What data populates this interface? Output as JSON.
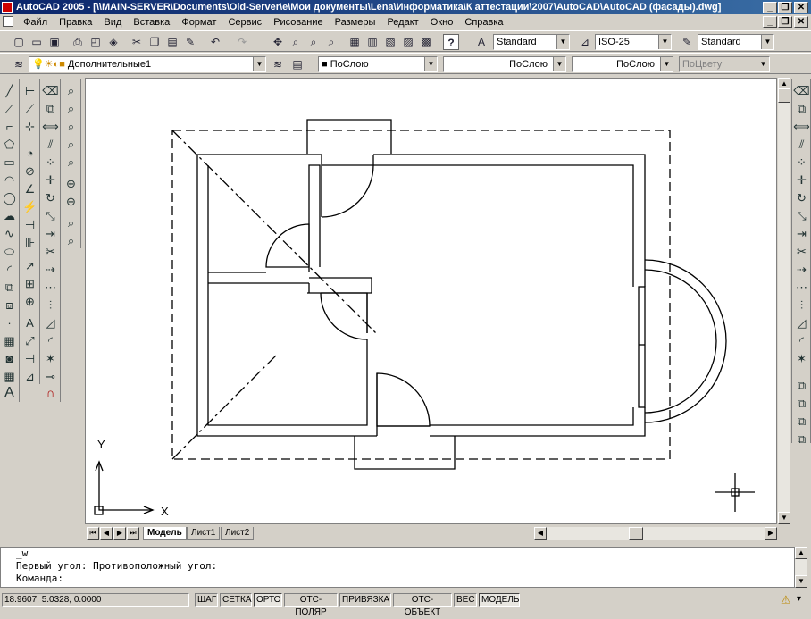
{
  "window": {
    "title": "AutoCAD 2005 - [\\\\MAIN-SERVER\\Documents\\Old-Server\\e\\Мои документы\\Lena\\Информатика\\К аттестации\\2007\\AutoCAD\\AutoCAD (фасады).dwg]",
    "min": "_",
    "restore": "❐",
    "close": "✕"
  },
  "menu": [
    "Файл",
    "Правка",
    "Вид",
    "Вставка",
    "Формат",
    "Сервис",
    "Рисование",
    "Размеры",
    "Редакт",
    "Окно",
    "Справка"
  ],
  "toolbar1": {
    "text_style": "Standard",
    "dim_style": "ISO-25",
    "table_style": "Standard"
  },
  "toolbar2": {
    "layer": "Дополнительные1",
    "color": "ПоСлою",
    "linetype": "ПоСлою",
    "lineweight": "ПоСлою",
    "plotstyle": "ПоЦвету"
  },
  "ucs": {
    "x_label": "X",
    "y_label": "Y"
  },
  "tabs": [
    "Модель",
    "Лист1",
    "Лист2"
  ],
  "command": {
    "line1": "_w",
    "line2": "Первый угол: Противоположный угол:",
    "line3": "Команда:"
  },
  "status": {
    "coords": "18.9607, 5.0328, 0.0000",
    "buttons": [
      "ШАГ",
      "СЕТКА",
      "ОРТО",
      "ОТС-ПОЛЯР",
      "ПРИВЯЗКА",
      "ОТС-ОБЪЕКТ",
      "ВЕС",
      "МОДЕЛЬ"
    ],
    "active": [
      "ОРТО",
      "МОДЕЛЬ"
    ]
  },
  "colors": {
    "title_start": "#0a246a",
    "title_end": "#3a6ea5",
    "canvas": "#ffffff",
    "chrome": "#d4d0c8"
  }
}
